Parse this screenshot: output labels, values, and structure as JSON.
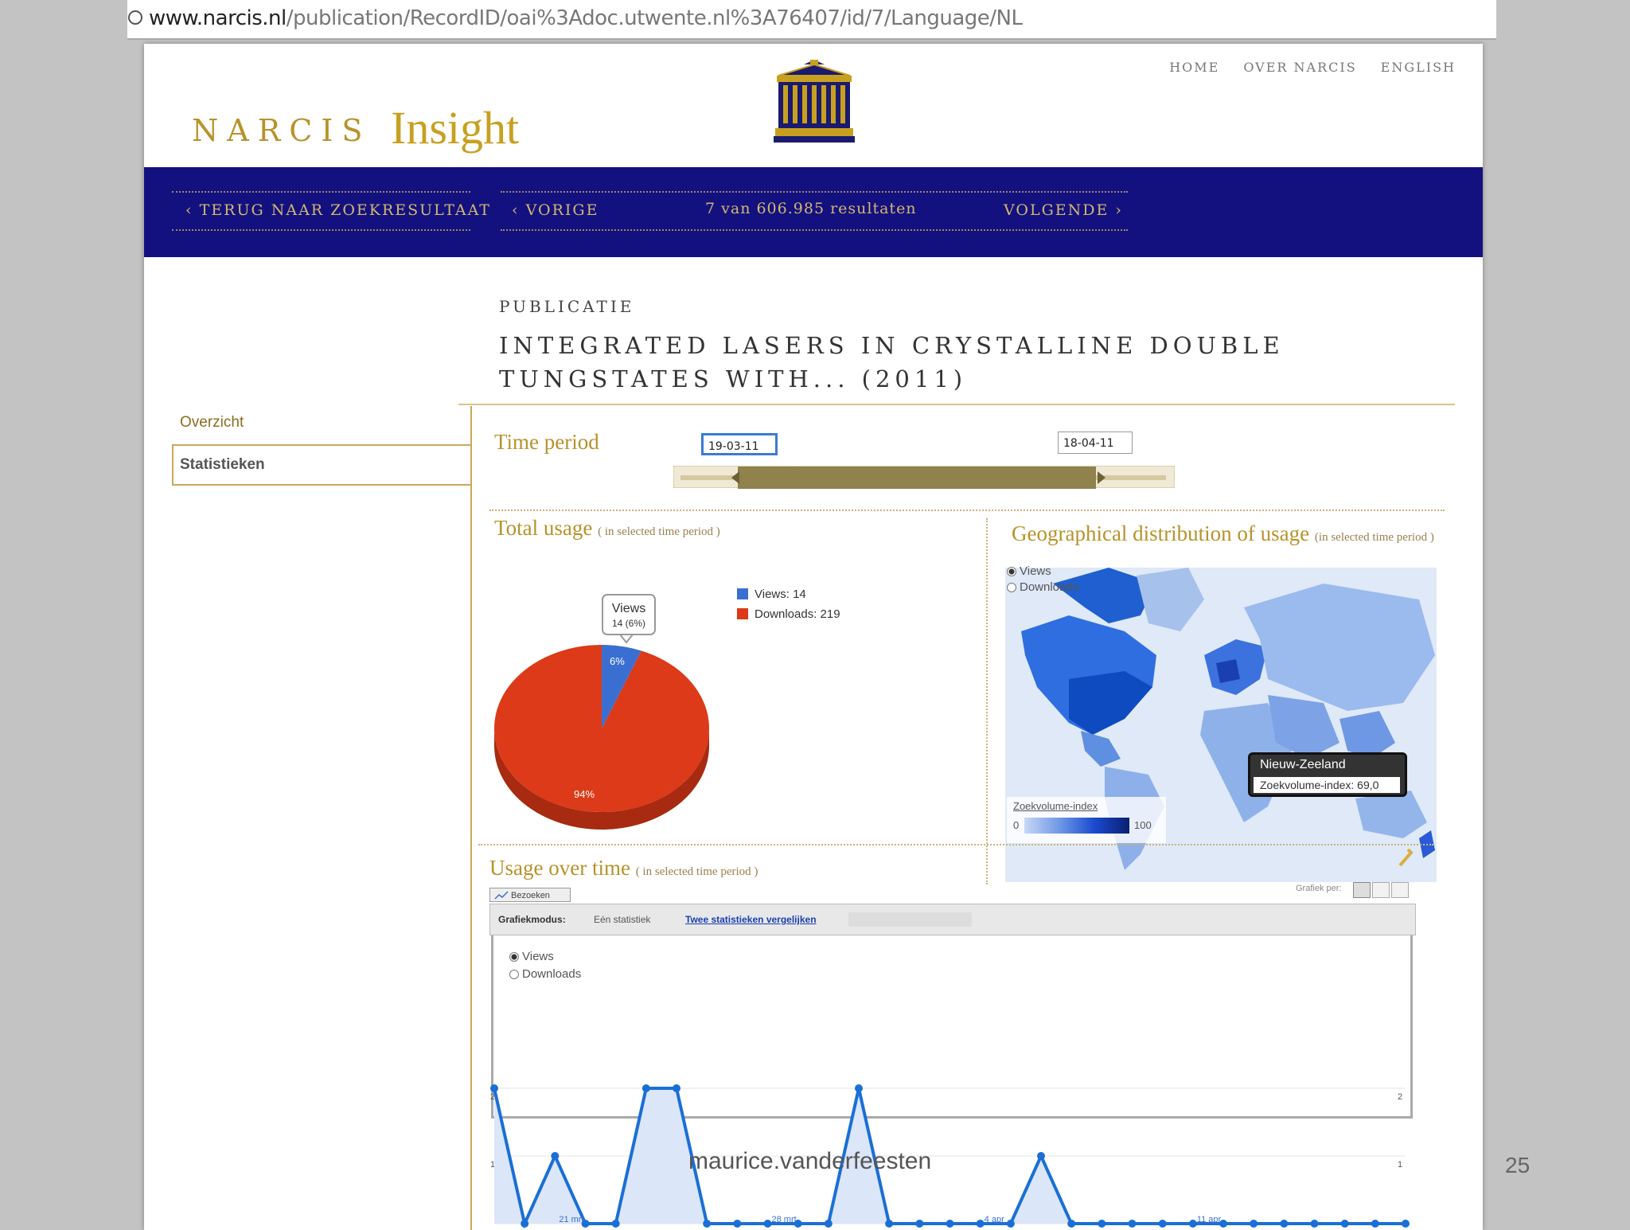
{
  "browser": {
    "url_domain": "www.narcis.nl",
    "url_path": "/publication/RecordID/oai%3Adoc.utwente.nl%3A76407/id/7/Language/NL"
  },
  "header": {
    "logo_narcis": "NARCIS",
    "logo_insight": "Insight",
    "nav": [
      "HOME",
      "OVER NARCIS",
      "ENGLISH"
    ]
  },
  "navband": {
    "back": "TERUG NAAR ZOEKRESULTAAT",
    "prev": "VORIGE",
    "count": "7 van 606.985 resultaten",
    "next": "VOLGENDE"
  },
  "publication": {
    "label": "PUBLICATIE",
    "title": "INTEGRATED LASERS IN CRYSTALLINE DOUBLE TUNGSTATES WITH... (2011)"
  },
  "sidebar": {
    "items": [
      "Overzicht",
      "Statistieken"
    ]
  },
  "time_period": {
    "label": "Time period",
    "start": "19-03-11",
    "end": "18-04-11"
  },
  "total_usage": {
    "title": "Total usage",
    "subtitle": "( in selected time period )",
    "tooltip_label": "Views",
    "tooltip_value": "14 (6%)",
    "legend": [
      "Views: 14",
      "Downloads: 219"
    ],
    "slice_labels": [
      "6%",
      "94%"
    ],
    "colors": {
      "views": "#3a6fd1",
      "downloads": "#dc3a18"
    }
  },
  "geo": {
    "title": "Geographical distribution of usage",
    "subtitle": "(in selected time period )",
    "radios": [
      "Views",
      "Downloads"
    ],
    "tooltip_country": "Nieuw-Zeeland",
    "tooltip_value": "Zoekvolume-index: 69,0",
    "scale_label": "Zoekvolume-index",
    "scale_min": "0",
    "scale_max": "100"
  },
  "usage_over_time": {
    "title": "Usage over time",
    "subtitle": "( in selected time period )",
    "tab": "Bezoeken",
    "grafiek_per": "Grafiek per:",
    "grafiekmodus": "Grafiekmodus:",
    "mode_one": "Eén statistiek",
    "mode_two": "Twee statistieken vergelijken",
    "radios": [
      "Views",
      "Downloads"
    ],
    "y_ticks": [
      "2",
      "1"
    ],
    "x_labels": [
      "21 mrt",
      "28 mrt",
      "4 apr",
      "11 apr"
    ]
  },
  "chart_data": {
    "type": "line",
    "series": [
      {
        "values": [
          2,
          0,
          1,
          0,
          0,
          2,
          2,
          0,
          0,
          0,
          0,
          0,
          2,
          0,
          0,
          0,
          0,
          0,
          1,
          0,
          0,
          0,
          0,
          0,
          0,
          0,
          0,
          0,
          0,
          0,
          0
        ]
      }
    ],
    "ylim": [
      0,
      2
    ]
  },
  "footer": {
    "author": "maurice.vanderfeesten",
    "slide_number": "25"
  }
}
